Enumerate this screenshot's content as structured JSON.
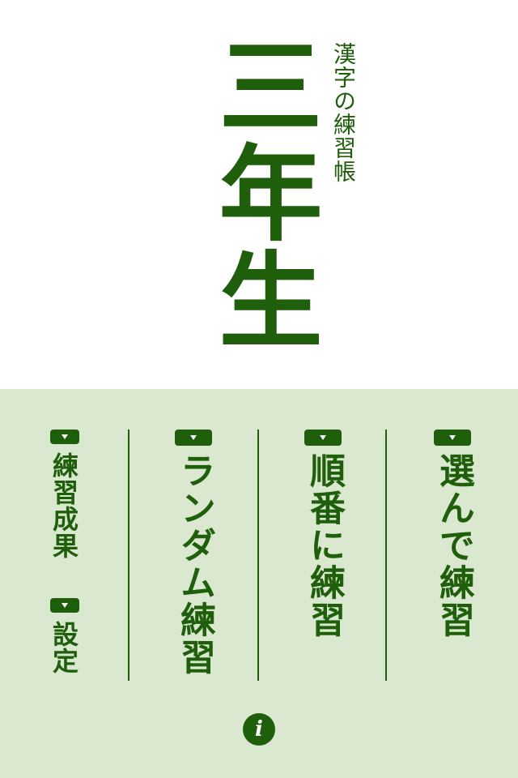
{
  "header": {
    "title": "三年生",
    "subtitle": "漢字の練習帳"
  },
  "menu": {
    "select_practice": "選んで練習",
    "sequential_practice": "順番に練習",
    "random_practice": "ランダム練習",
    "results": "練習成果",
    "settings": "設定"
  },
  "icons": {
    "marker": "triangle-down-icon",
    "info": "info-icon",
    "info_glyph": "i"
  },
  "colors": {
    "accent": "#1f5e0b",
    "panel": "#d9e8cf",
    "top_bg": "#ffffff"
  }
}
